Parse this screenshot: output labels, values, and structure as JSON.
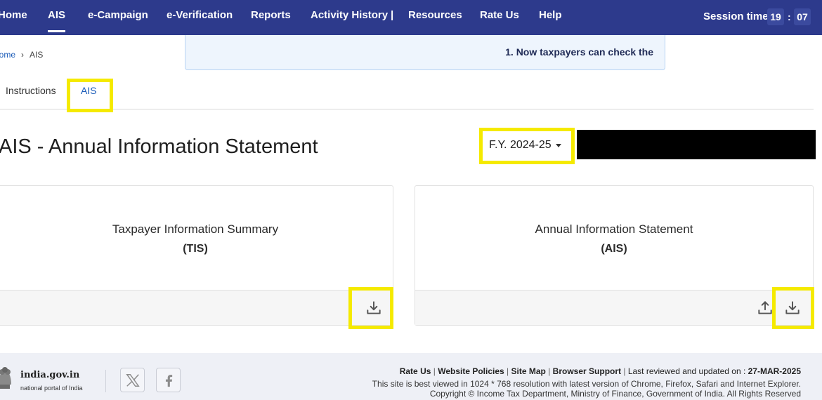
{
  "nav": {
    "items": [
      "Home",
      "AIS",
      "e-Campaign",
      "e-Verification",
      "Reports",
      "Activity History",
      "Resources",
      "Rate Us",
      "Help"
    ],
    "separator": "|",
    "session_label": "Session time",
    "session_minutes": "19",
    "session_colon": ":",
    "session_seconds": "07"
  },
  "breadcrumb": {
    "home": "Home",
    "separator": "›",
    "current": "AIS"
  },
  "announcement": "1.  Now taxpayers can check the",
  "tabs": [
    {
      "label": "Instructions",
      "active": false
    },
    {
      "label": "AIS",
      "active": true
    }
  ],
  "page_title": "AIS - Annual Information Statement",
  "fy_select": {
    "value": "F.Y. 2024-25"
  },
  "cards": [
    {
      "title": "Taxpayer Information Summary",
      "subtitle": "(TIS)",
      "actions": [
        "download-icon"
      ]
    },
    {
      "title": "Annual Information Statement",
      "subtitle": "(AIS)",
      "actions": [
        "upload-icon",
        "download-icon"
      ]
    }
  ],
  "footer": {
    "gov_name": "india.gov.in",
    "gov_sub": "national portal of India",
    "links": [
      "Rate Us",
      "Website Policies",
      "Site Map",
      "Browser Support"
    ],
    "link_sep": "|",
    "last_reviewed_label": "Last reviewed and updated on : ",
    "last_reviewed_date": "27-MAR-2025",
    "browser_note": "This site is best viewed in 1024 * 768 resolution with latest version of Chrome, Firefox, Safari and Internet Explorer.",
    "copyright": "Copyright © Income Tax Department, Ministry of Finance, Government of India. All Rights Reserved"
  },
  "colors": {
    "nav_bg": "#2d3a8c",
    "highlight": "#f5ea00",
    "link_blue": "#1a5bb8",
    "footer_bg": "#eef0f6"
  }
}
